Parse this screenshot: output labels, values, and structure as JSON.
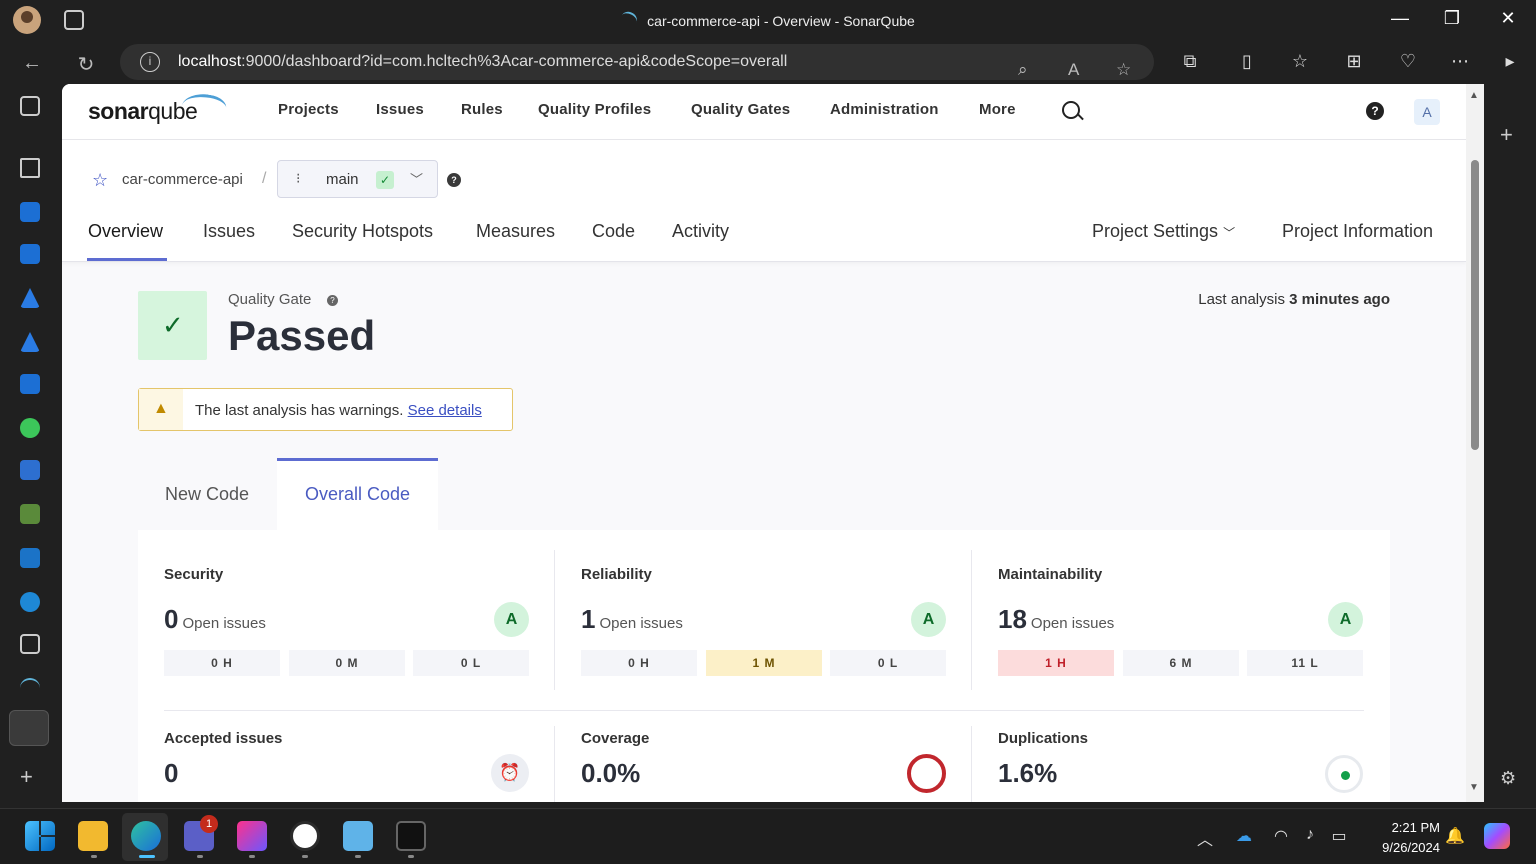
{
  "window": {
    "title": "car-commerce-api - Overview - SonarQube",
    "minimize_label": "—",
    "restore_label": "❐",
    "close_label": "✕"
  },
  "browser": {
    "url_host": "localhost",
    "url_rest": ":9000/dashboard?id=com.hcltech%3Acar-commerce-api&codeScope=overall"
  },
  "sonar": {
    "logo_main": "sonar",
    "logo_second": "qube",
    "nav": [
      "Projects",
      "Issues",
      "Rules",
      "Quality Profiles",
      "Quality Gates",
      "Administration",
      "More"
    ],
    "user_initial": "A",
    "help_label": "?"
  },
  "project": {
    "name": "car-commerce-api",
    "separator": "/",
    "branch": "main",
    "tabs": [
      "Overview",
      "Issues",
      "Security Hotspots",
      "Measures",
      "Code",
      "Activity"
    ],
    "settings_label": "Project Settings",
    "info_label": "Project Information"
  },
  "quality_gate": {
    "label": "Quality Gate",
    "status": "Passed",
    "last_analysis_prefix": "Last analysis",
    "last_analysis_time": "3 minutes ago"
  },
  "warning": {
    "text": "The last analysis has warnings.",
    "link": "See details"
  },
  "code_tabs": {
    "new": "New Code",
    "overall": "Overall Code"
  },
  "metrics": {
    "open_issues_label": "Open issues",
    "security": {
      "title": "Security",
      "value": "0",
      "grade": "A",
      "high": "0 H",
      "medium": "0 M",
      "low": "0 L"
    },
    "reliability": {
      "title": "Reliability",
      "value": "1",
      "grade": "A",
      "high": "0 H",
      "medium": "1 M",
      "low": "0 L"
    },
    "maintainability": {
      "title": "Maintainability",
      "value": "18",
      "grade": "A",
      "high": "1 H",
      "medium": "6 M",
      "low": "11 L"
    },
    "accepted": {
      "title": "Accepted issues",
      "value": "0"
    },
    "coverage": {
      "title": "Coverage",
      "value": "0.0%"
    },
    "duplications": {
      "title": "Duplications",
      "value": "1.6%"
    }
  },
  "taskbar": {
    "time": "2:21 PM",
    "date": "9/26/2024",
    "teams_badge": "1"
  }
}
